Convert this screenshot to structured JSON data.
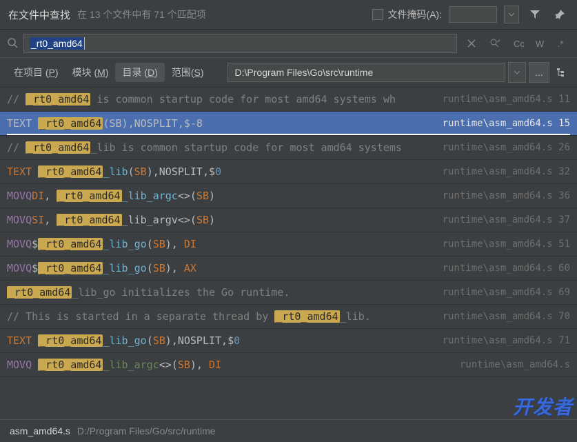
{
  "header": {
    "title": "在文件中查找",
    "count_text": "在 13 个文件中有 71 个匹配项",
    "filemask_label": "文件掩码(A):"
  },
  "search": {
    "query": "_rt0_amd64",
    "opt_cc": "Cc",
    "opt_w": "W",
    "opt_regex": ".*"
  },
  "scope": {
    "tabs": [
      {
        "label": "在项目 (",
        "mnemonic": "P",
        "suffix": ")"
      },
      {
        "label": "模块 (",
        "mnemonic": "M",
        "suffix": ")"
      },
      {
        "label": "目录 (",
        "mnemonic": "D",
        "suffix": ")"
      },
      {
        "label": "范围(",
        "mnemonic": "S",
        "suffix": ")"
      }
    ],
    "path": "D:\\Program Files\\Go\\src\\runtime"
  },
  "results": [
    {
      "segments": [
        {
          "text": "// ",
          "cls": "c-comment"
        },
        {
          "text": "_rt0_amd64",
          "cls": "hlt"
        },
        {
          "text": " is common startup code for most amd64 systems wh",
          "cls": "c-comment"
        }
      ],
      "file": "runtime\\asm_amd64.s",
      "line": "11",
      "selected": false
    },
    {
      "segments": [
        {
          "text": "TEXT ",
          "cls": "c-plain"
        },
        {
          "text": "_rt0_amd64",
          "cls": "hlt"
        },
        {
          "text": "(SB),NOSPLIT,$-8",
          "cls": "c-plain"
        }
      ],
      "file": "runtime\\asm_amd64.s",
      "line": "15",
      "selected": true
    },
    {
      "segments": [
        {
          "text": "// ",
          "cls": "c-comment"
        },
        {
          "text": "_rt0_amd64",
          "cls": "hlt"
        },
        {
          "text": "_lib is common startup code for most amd64 systems",
          "cls": "c-comment"
        }
      ],
      "file": "runtime\\asm_amd64.s",
      "line": "26",
      "selected": false
    },
    {
      "segments": [
        {
          "text": "TEXT ",
          "cls": "c-keyword"
        },
        {
          "text": "_rt0_amd64",
          "cls": "hlt"
        },
        {
          "text": "_lib",
          "cls": "c-func"
        },
        {
          "text": "(",
          "cls": "c-plain"
        },
        {
          "text": "SB",
          "cls": "c-reg"
        },
        {
          "text": "),NOSPLIT,$",
          "cls": "c-plain"
        },
        {
          "text": "0",
          "cls": "c-num"
        }
      ],
      "file": "runtime\\asm_amd64.s",
      "line": "32",
      "selected": false
    },
    {
      "segments": [
        {
          "text": "MOVQ",
          "cls": "c-inst"
        },
        {
          "text": "DI",
          "cls": "c-reg"
        },
        {
          "text": ", ",
          "cls": "c-plain"
        },
        {
          "text": "_rt0_amd64",
          "cls": "hlt"
        },
        {
          "text": "_lib_argc",
          "cls": "c-func"
        },
        {
          "text": "<>(",
          "cls": "c-plain"
        },
        {
          "text": "SB",
          "cls": "c-reg"
        },
        {
          "text": ")",
          "cls": "c-plain"
        }
      ],
      "file": "runtime\\asm_amd64.s",
      "line": "36",
      "selected": false
    },
    {
      "segments": [
        {
          "text": "MOVQ",
          "cls": "c-inst"
        },
        {
          "text": "SI",
          "cls": "c-reg"
        },
        {
          "text": ", ",
          "cls": "c-plain"
        },
        {
          "text": "_rt0_amd64",
          "cls": "hlt"
        },
        {
          "text": "_lib_argv",
          "cls": "c-plain"
        },
        {
          "text": "<>(",
          "cls": "c-plain"
        },
        {
          "text": "SB",
          "cls": "c-reg"
        },
        {
          "text": ")",
          "cls": "c-plain"
        }
      ],
      "file": "runtime\\asm_amd64.s",
      "line": "37",
      "selected": false
    },
    {
      "segments": [
        {
          "text": "MOVQ",
          "cls": "c-inst"
        },
        {
          "text": "$",
          "cls": "c-plain"
        },
        {
          "text": "_rt0_amd64",
          "cls": "hlt"
        },
        {
          "text": "_lib_go",
          "cls": "c-func"
        },
        {
          "text": "(",
          "cls": "c-plain"
        },
        {
          "text": "SB",
          "cls": "c-reg"
        },
        {
          "text": "), ",
          "cls": "c-plain"
        },
        {
          "text": "DI",
          "cls": "c-reg"
        }
      ],
      "file": "runtime\\asm_amd64.s",
      "line": "51",
      "selected": false
    },
    {
      "segments": [
        {
          "text": "MOVQ",
          "cls": "c-inst"
        },
        {
          "text": "$",
          "cls": "c-plain"
        },
        {
          "text": "_rt0_amd64",
          "cls": "hlt"
        },
        {
          "text": "_lib_go",
          "cls": "c-func"
        },
        {
          "text": "(",
          "cls": "c-plain"
        },
        {
          "text": "SB",
          "cls": "c-reg"
        },
        {
          "text": "), ",
          "cls": "c-plain"
        },
        {
          "text": "AX",
          "cls": "c-reg"
        }
      ],
      "file": "runtime\\asm_amd64.s",
      "line": "60",
      "selected": false
    },
    {
      "segments": [
        {
          "text": "_rt0_amd64",
          "cls": "hlt"
        },
        {
          "text": "_lib_go initializes the Go runtime.",
          "cls": "c-comment"
        }
      ],
      "file": "runtime\\asm_amd64.s",
      "line": "69",
      "selected": false
    },
    {
      "segments": [
        {
          "text": "// This is started in a separate thread by ",
          "cls": "c-comment"
        },
        {
          "text": "_rt0_amd64",
          "cls": "hlt"
        },
        {
          "text": "_lib.",
          "cls": "c-comment"
        }
      ],
      "file": "runtime\\asm_amd64.s",
      "line": "70",
      "selected": false
    },
    {
      "segments": [
        {
          "text": "TEXT ",
          "cls": "c-keyword"
        },
        {
          "text": "_rt0_amd64",
          "cls": "hlt"
        },
        {
          "text": "_lib_go",
          "cls": "c-func"
        },
        {
          "text": "(",
          "cls": "c-plain"
        },
        {
          "text": "SB",
          "cls": "c-reg"
        },
        {
          "text": "),NOSPLIT,$",
          "cls": "c-plain"
        },
        {
          "text": "0",
          "cls": "c-num"
        }
      ],
      "file": "runtime\\asm_amd64.s",
      "line": "71",
      "selected": false
    },
    {
      "segments": [
        {
          "text": "MOVQ ",
          "cls": "c-inst"
        },
        {
          "text": "_rt0_amd64",
          "cls": "hlt"
        },
        {
          "text": "_lib_argc",
          "cls": "c-func2"
        },
        {
          "text": "<>(",
          "cls": "c-plain"
        },
        {
          "text": "SB",
          "cls": "c-reg"
        },
        {
          "text": "), ",
          "cls": "c-plain"
        },
        {
          "text": "DI",
          "cls": "c-reg"
        }
      ],
      "file": "runtime\\asm_amd64.s",
      "line": "",
      "selected": false
    }
  ],
  "footer": {
    "filename": "asm_amd64.s",
    "filepath": "D:/Program Files/Go/src/runtime"
  },
  "watermark": "开发者"
}
